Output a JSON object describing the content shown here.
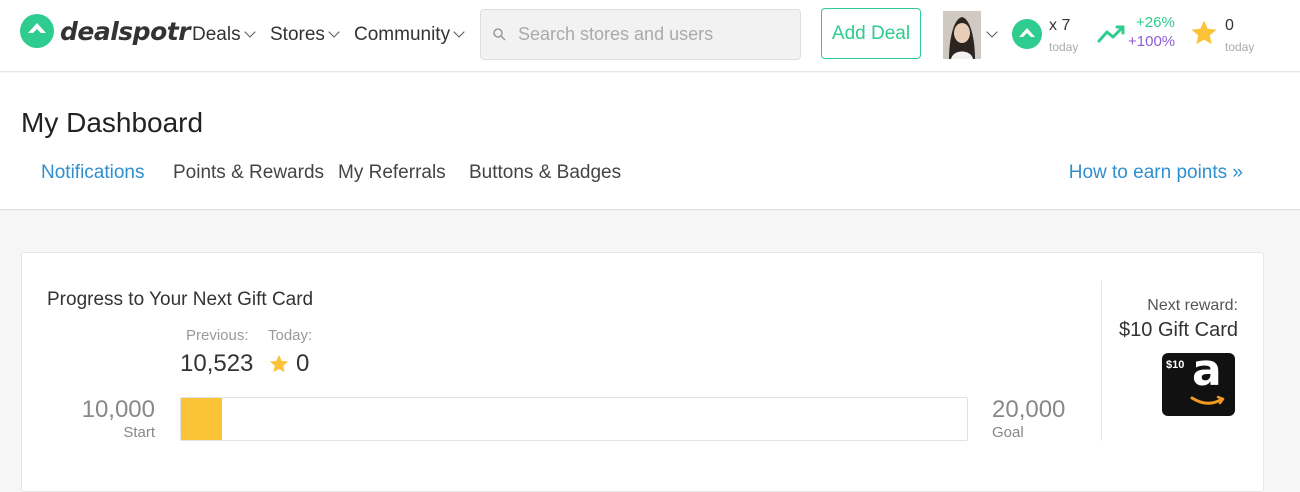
{
  "brand": {
    "name": "dealspotr",
    "color": "#2ecc8f"
  },
  "nav": {
    "items": [
      {
        "label": "Deals"
      },
      {
        "label": "Stores"
      },
      {
        "label": "Community"
      }
    ],
    "search_placeholder": "Search stores and users",
    "add_deal_label": "Add Deal"
  },
  "user_stats": {
    "upvotes_count": "x 7",
    "upvotes_period": "today",
    "trend_top": "+26%",
    "trend_bottom": "+100%",
    "points_count": "0",
    "points_period": "today"
  },
  "dashboard": {
    "title": "My Dashboard",
    "tabs": [
      {
        "label": "Notifications",
        "active": true
      },
      {
        "label": "Points & Rewards",
        "active": false
      },
      {
        "label": "My Referrals",
        "active": false
      },
      {
        "label": "Buttons & Badges",
        "active": false
      }
    ],
    "earn_link": "How to earn points »"
  },
  "progress": {
    "title": "Progress to Your Next Gift Card",
    "previous_label": "Previous:",
    "previous_value": "10,523",
    "today_label": "Today:",
    "today_value": "0",
    "start_value": "10,000",
    "start_label": "Start",
    "goal_value": "20,000",
    "goal_label": "Goal",
    "fill_fraction": 0.0523,
    "fill_color": "#fbc338",
    "next_reward_label": "Next reward:",
    "next_reward_name": "$10 Gift Card",
    "gift_card_amount": "$10",
    "gift_card_letter": "a"
  },
  "colors": {
    "link": "#2f8fcf",
    "accent": "#2ecc8f",
    "trend_purple": "#8e5bd6",
    "star": "#fbc338"
  }
}
